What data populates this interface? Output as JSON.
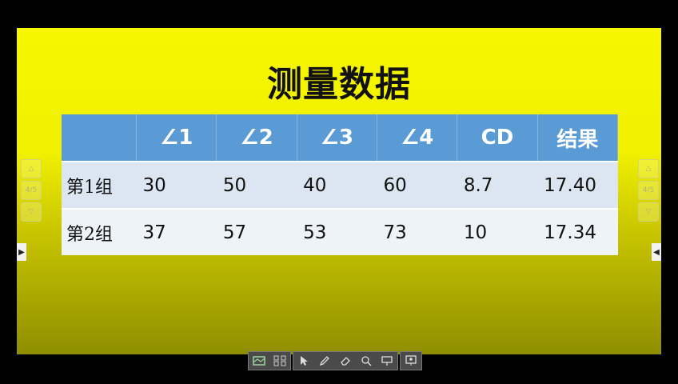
{
  "slide": {
    "title": "测量数据",
    "table": {
      "headers": [
        "",
        "∠1",
        "∠2",
        "∠3",
        "∠4",
        "CD",
        "结果"
      ],
      "rows": [
        [
          "第1组",
          "30",
          "50",
          "40",
          "60",
          "8.7",
          "17.40"
        ],
        [
          "第2组",
          "37",
          "57",
          "53",
          "73",
          "10",
          "17.34"
        ]
      ]
    }
  },
  "nav": {
    "page_indicator": "4/5",
    "up_icon": "triangle-up-icon",
    "down_icon": "triangle-down-icon"
  },
  "toolbar": {
    "icons": [
      "slideshow-icon",
      "grid-icon",
      "pointer-icon",
      "pen-icon",
      "eraser-icon",
      "magnifier-icon",
      "screen-icon",
      "presenter-icon"
    ]
  },
  "colors": {
    "header_bg": "#5b9bd5",
    "row1_bg": "#dce6f2",
    "row2_bg": "#eef3f8",
    "slide_top": "#f6f600",
    "slide_bottom": "#8f8e00"
  }
}
